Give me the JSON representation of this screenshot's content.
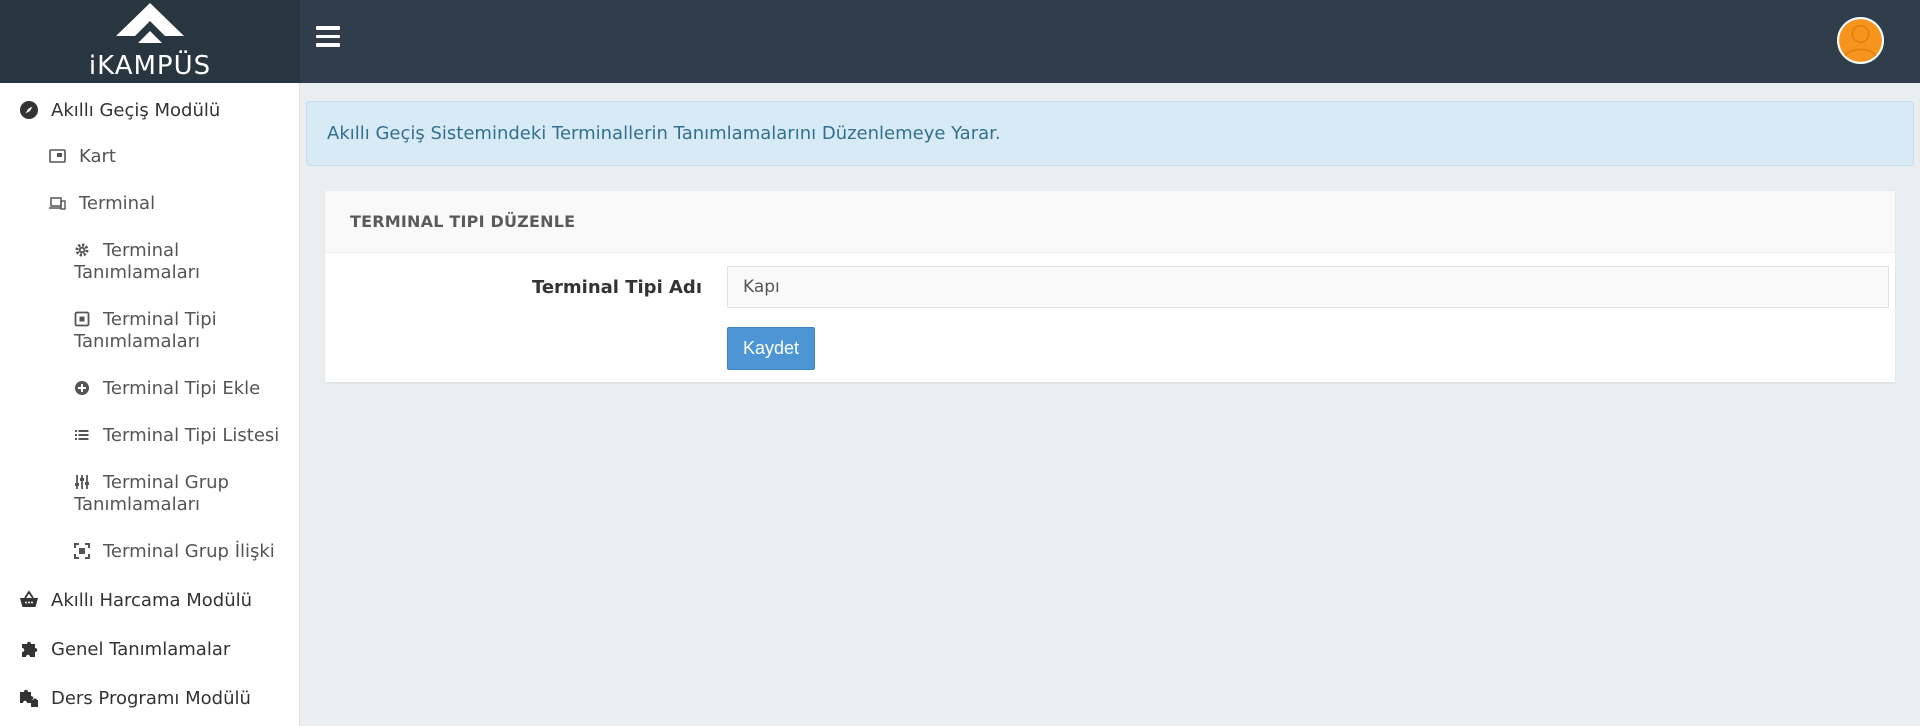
{
  "app": {
    "logo_text": "iKAMPÜS"
  },
  "sidebar": {
    "items": [
      {
        "label": "Akıllı Geçiş Modülü",
        "icon": "compass-icon"
      },
      {
        "label": "Kart",
        "icon": "card-icon"
      },
      {
        "label": "Terminal",
        "icon": "devices-icon"
      },
      {
        "label_line1": "Terminal",
        "label_line2": "Tanımlamaları",
        "icon": "gear-icon"
      },
      {
        "label_line1": "Terminal Tipi",
        "label_line2": "Tanımlamaları",
        "icon": "box-icon"
      },
      {
        "label": "Terminal Tipi Ekle",
        "icon": "plus-circle-icon"
      },
      {
        "label": "Terminal Tipi Listesi",
        "icon": "list-icon"
      },
      {
        "label_line1": "Terminal Grup",
        "label_line2": "Tanımlamaları",
        "icon": "sliders-icon"
      },
      {
        "label": "Terminal Grup İlişki",
        "icon": "expand-icon"
      },
      {
        "label": "Akıllı Harcama Modülü",
        "icon": "basket-icon"
      },
      {
        "label": "Genel Tanımlamalar",
        "icon": "puzzle-icon"
      },
      {
        "label": "Ders Programı Modülü",
        "icon": "puzzles-icon"
      }
    ]
  },
  "main": {
    "info_text": "Akıllı Geçiş Sistemindeki Terminallerin Tanımlamalarını Düzenlemeye Yarar.",
    "panel_title": "TERMINAL TIPI DÜZENLE",
    "form": {
      "label": "Terminal Tipi Adı",
      "value": "Kapı",
      "save_label": "Kaydet"
    }
  },
  "colors": {
    "header_bg": "#2f3e4a",
    "info_bg": "#d9eaf7",
    "accent": "#4d95d4",
    "avatar": "#f7941d"
  }
}
